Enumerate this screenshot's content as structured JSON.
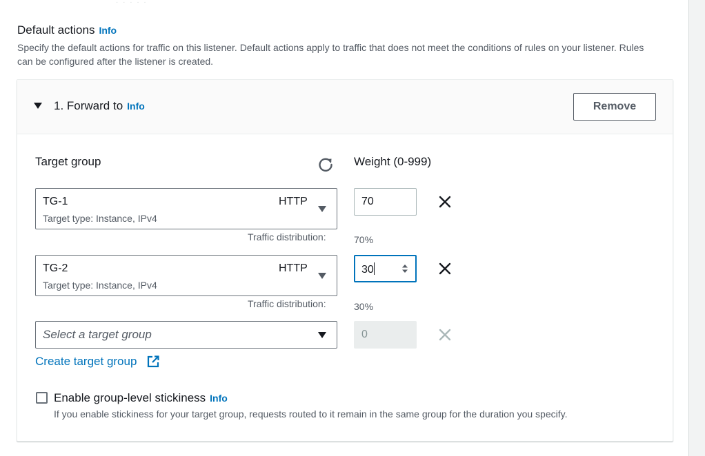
{
  "section": {
    "title": "Default actions",
    "info": "Info",
    "description": "Specify the default actions for traffic on this listener. Default actions apply to traffic that does not meet the conditions of rules on your listener. Rules can be configured after the listener is created."
  },
  "action": {
    "title": "1. Forward to",
    "info": "Info",
    "remove_label": "Remove",
    "target_group_label": "Target group",
    "weight_label": "Weight (0-999)",
    "traffic_distribution_label": "Traffic distribution:",
    "groups": [
      {
        "name": "TG-1",
        "protocol": "HTTP",
        "subtitle": "Target type: Instance, IPv4",
        "weight": "70",
        "distribution": "70%"
      },
      {
        "name": "TG-2",
        "protocol": "HTTP",
        "subtitle": "Target type: Instance, IPv4",
        "weight": "30",
        "distribution": "30%"
      }
    ],
    "new_group": {
      "placeholder": "Select a target group",
      "weight": "0"
    },
    "create_link": "Create target group",
    "stickiness": {
      "label": "Enable group-level stickiness",
      "info": "Info",
      "description": "If you enable stickiness for your target group, requests routed to it remain in the same group for the duration you specify.",
      "checked": false
    }
  },
  "colors": {
    "link": "#0073bb",
    "text": "#16191f",
    "secondary_text": "#545b64",
    "focus_border": "#0073bb"
  }
}
